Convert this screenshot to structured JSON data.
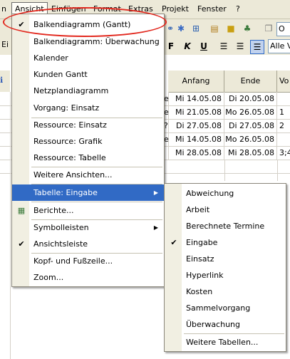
{
  "menubar": [
    "n",
    "Ansicht",
    "Einfügen",
    "Format",
    "Extras",
    "Projekt",
    "Fenster",
    "?"
  ],
  "toolbar": {
    "format_buttons": [
      "F",
      "K",
      "U"
    ],
    "font_combo": "Ei",
    "view_combo": "Alle V",
    "right_combo": "O"
  },
  "table": {
    "headers": [
      "Anfang",
      "Ende",
      "Vo"
    ],
    "rows": [
      {
        "edge": "e",
        "start": "Mi 14.05.08",
        "end": "Di 20.05.08",
        "pred": ""
      },
      {
        "edge": "e",
        "start": "Mi 21.05.08",
        "end": "Mo 26.05.08",
        "pred": "1"
      },
      {
        "edge": "?",
        "start": "Di 27.05.08",
        "end": "Di 27.05.08",
        "pred": "2"
      },
      {
        "edge": "e",
        "start": "Mi 14.05.08",
        "end": "Mo 26.05.08",
        "pred": ""
      },
      {
        "edge": "",
        "start": "Mi 28.05.08",
        "end": "Mi 28.05.08",
        "pred": "3;4"
      }
    ]
  },
  "ansicht_menu": [
    {
      "label": "Balkendiagramm (Gantt)",
      "checked": true
    },
    {
      "label": "Balkendiagramm: Überwachung"
    },
    {
      "label": "Kalender"
    },
    {
      "label": "Kunden Gantt"
    },
    {
      "label": "Netzplandiagramm"
    },
    {
      "label": "Vorgang: Einsatz"
    },
    {
      "sep": true
    },
    {
      "label": "Ressource: Einsatz"
    },
    {
      "label": "Ressource: Grafik"
    },
    {
      "label": "Ressource: Tabelle"
    },
    {
      "sep": true
    },
    {
      "label": "Weitere Ansichten..."
    },
    {
      "sep": true
    },
    {
      "label": "Tabelle: Eingabe",
      "submenu": true,
      "highlight": true
    },
    {
      "sep": true
    },
    {
      "label": "Berichte...",
      "icon": true
    },
    {
      "sep": true
    },
    {
      "label": "Symbolleisten",
      "submenu": true
    },
    {
      "label": "Ansichtsleiste",
      "checked": true
    },
    {
      "sep": true
    },
    {
      "label": "Kopf- und Fußzeile..."
    },
    {
      "label": "Zoom..."
    }
  ],
  "tabelle_submenu": [
    {
      "label": "Abweichung"
    },
    {
      "label": "Arbeit"
    },
    {
      "label": "Berechnete Termine"
    },
    {
      "label": "Eingabe",
      "checked": true
    },
    {
      "label": "Einsatz"
    },
    {
      "label": "Hyperlink"
    },
    {
      "label": "Kosten"
    },
    {
      "label": "Sammelvorgang"
    },
    {
      "label": "Überwachung"
    },
    {
      "sep": true
    },
    {
      "label": "Weitere Tabellen..."
    }
  ],
  "colors": {
    "highlight": "#316ac5",
    "annotation": "#e2281e"
  }
}
